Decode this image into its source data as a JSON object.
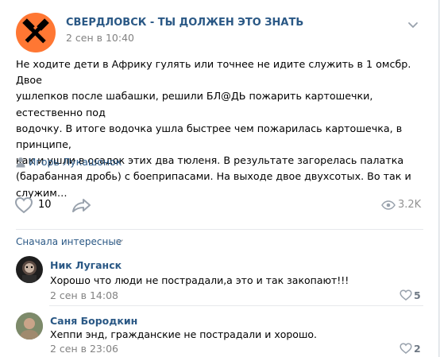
{
  "post": {
    "group_name": "СВЕРДЛОВСК - ТЫ ДОЛЖЕН ЭТО ЗНАТЬ",
    "date": "2 сен в 10:40",
    "text": "Не ходите дети в Африку гулять или точнее не идите служить в 1 омсбр. Двое\nушлепков после шабашки, решили БЛ@ДЬ пожарить картошечки, естественно под\nводочку. В итоге водочка ушла быстрее чем пожарилась картошечка, в принципе,\nкак и ушли в осадок этих два тюленя. В результате загорелась палатка\n(барабанная дробь) с боеприпасами. На выходе двое двухсотых. Во так и\nслужим…",
    "signer": "Игорь Лукашонок",
    "likes": "10",
    "views": "3.2K"
  },
  "comments_sort": "Сначала интересные",
  "comments": [
    {
      "author": "Ник Луганск",
      "text": "Хорошо что люди не пострадали,а это и так закопают!!!",
      "date": "2 сен в 14:08",
      "likes": "5"
    },
    {
      "author": "Саня Бородкин",
      "text": "Хеппи энд, гражданские не пострадали и хорошо.",
      "date": "2 сен в 23:06",
      "likes": "2"
    }
  ],
  "icons": {
    "group_avatar": "crossed-hammers-icon",
    "menu": "chevron-down-icon",
    "signer": "user-icon",
    "like": "heart-icon",
    "share": "share-arrow-icon",
    "views": "eye-icon"
  },
  "colors": {
    "link": "#2a5885",
    "avatar_bg": "#ff7733",
    "muted": "#828282",
    "icon": "#99a2ad"
  }
}
